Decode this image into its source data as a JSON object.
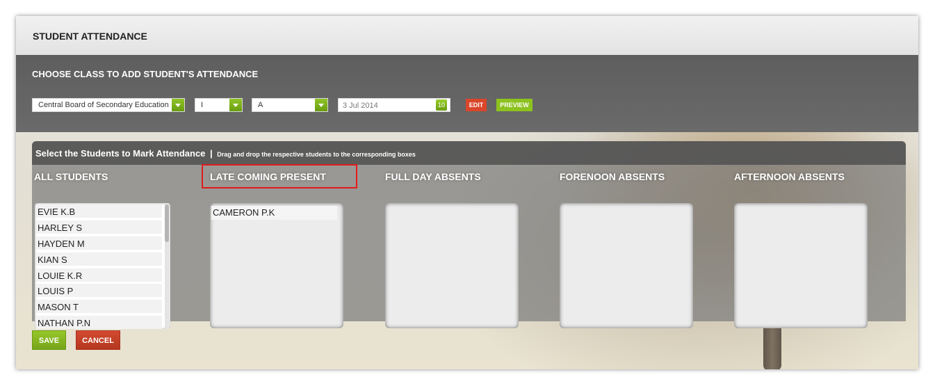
{
  "header": {
    "title": "STUDENT ATTENDANCE"
  },
  "filters": {
    "heading": "CHOOSE CLASS TO ADD STUDENT'S ATTENDANCE",
    "board": "Central Board of Secondary Education",
    "class": "I",
    "section": "A",
    "date": "3 Jul 2014",
    "calendar_day": "10",
    "edit_label": "EDIT",
    "preview_label": "PREVIEW"
  },
  "attendance": {
    "title": "Select the Students to Mark Attendance",
    "separator": "|",
    "hint": "Drag and drop the respective students to the corresponding boxes",
    "columns": {
      "all": "ALL STUDENTS",
      "late": "LATE COMING PRESENT",
      "full_day": "FULL DAY ABSENTS",
      "forenoon": "FORENOON ABSENTS",
      "afternoon": "AFTERNOON ABSENTS"
    },
    "all_students": [
      "EVIE K.B",
      "HARLEY S",
      "HAYDEN M",
      "KIAN S",
      "LOUIE K.R",
      "LOUIS P",
      "MASON T",
      "NATHAN P.N"
    ],
    "late_students": [
      "CAMERON P.K"
    ]
  },
  "actions": {
    "save": "SAVE",
    "cancel": "CANCEL"
  },
  "colors": {
    "accent_green": "#8dc21f",
    "accent_red": "#d9462a",
    "highlight": "#e11b1b"
  }
}
